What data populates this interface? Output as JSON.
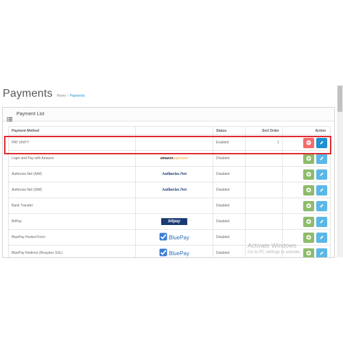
{
  "header": {
    "title": "Payments",
    "breadcrumb": [
      {
        "label": "Home",
        "current": false
      },
      {
        "label": "Payments",
        "current": true
      }
    ],
    "separator": "/"
  },
  "panel": {
    "title": "Payment List",
    "icon": "list-icon"
  },
  "table": {
    "columns": [
      "Payment Method",
      "",
      "Status",
      "Sort Order",
      "Action"
    ],
    "rows": [
      {
        "method": "PAY UNITY",
        "logo": "",
        "status": "Enabled",
        "sort_order": "1",
        "installed": true,
        "highlighted": true
      },
      {
        "method": "Login and Pay with Amazon",
        "logo": "amazon",
        "status": "Disabled",
        "sort_order": "",
        "installed": false
      },
      {
        "method": "Authorize.Net (AIM)",
        "logo": "authnet",
        "status": "Disabled",
        "sort_order": "",
        "installed": false
      },
      {
        "method": "Authorize.Net (SIM)",
        "logo": "authnet",
        "status": "Disabled",
        "sort_order": "",
        "installed": false
      },
      {
        "method": "Bank Transfer",
        "logo": "",
        "status": "Disabled",
        "sort_order": "",
        "installed": false
      },
      {
        "method": "BitPay",
        "logo": "bitpay",
        "status": "Disabled",
        "sort_order": "",
        "installed": false
      },
      {
        "method": "BluePay Hosted Form",
        "logo": "bluepay",
        "status": "Disabled",
        "sort_order": "",
        "installed": false
      },
      {
        "method": "BluePay Redirect (Requires SSL)",
        "logo": "bluepay",
        "status": "Disabled",
        "sort_order": "",
        "installed": false
      }
    ]
  },
  "logos": {
    "amazon": {
      "part1": "amazon",
      "part2": "payments"
    },
    "authnet": {
      "text": "Authorize.Net"
    },
    "bitpay": {
      "text": "bitpay"
    },
    "bluepay": {
      "text": "BluePay"
    }
  },
  "watermark": {
    "title": "Activate Windows",
    "subtitle": "Go to PC settings to activate"
  },
  "colors": {
    "highlight": "#e0282e",
    "uninstall": "#f56b6b",
    "install": "#8fbb6c",
    "edit_active": "#1e91cf",
    "edit_inactive": "#5bb8e6",
    "link": "#1e91cf"
  }
}
